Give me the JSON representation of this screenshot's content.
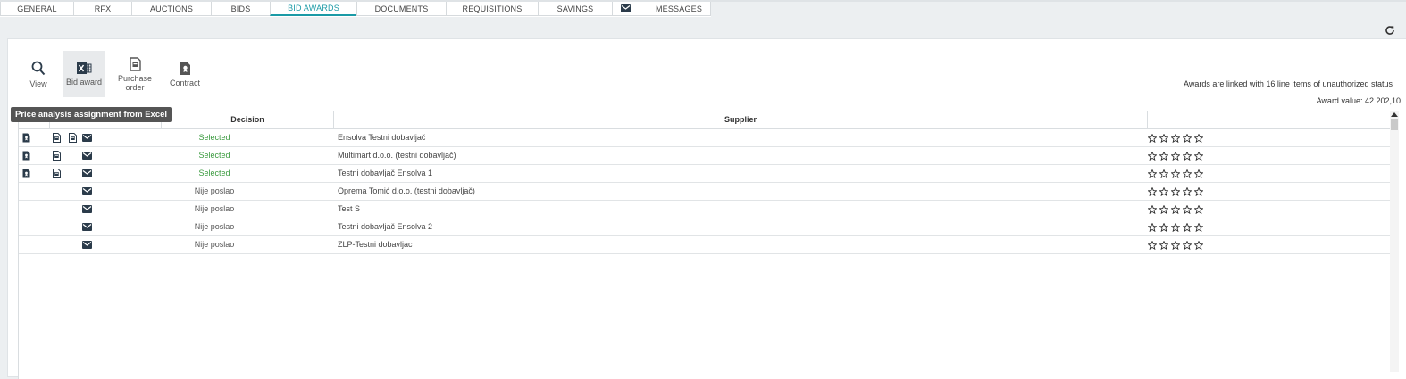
{
  "tabs": [
    {
      "label": "GENERAL",
      "active": false
    },
    {
      "label": "RFX",
      "active": false
    },
    {
      "label": "AUCTIONS",
      "active": false
    },
    {
      "label": "BIDS",
      "active": false
    },
    {
      "label": "BID AWARDS",
      "active": true
    },
    {
      "label": "DOCUMENTS",
      "active": false
    },
    {
      "label": "REQUISITIONS",
      "active": false
    },
    {
      "label": "SAVINGS",
      "active": false
    },
    {
      "label": "MESSAGES",
      "active": false,
      "icon": "envelope-icon"
    }
  ],
  "toolbar": {
    "view_label": "View",
    "bid_award_label": "Bid award",
    "purchase_order_label_1": "Purchase",
    "purchase_order_label_2": "order",
    "contract_label": "Contract"
  },
  "info": {
    "linked_text": "Awards are linked with 16 line items of unauthorized status",
    "award_value_text": "Award value: 42.202,10"
  },
  "tooltip": "Price analysis assignment from Excel",
  "table": {
    "headers": {
      "decision": "Decision",
      "supplier": "Supplier"
    },
    "rows": [
      {
        "decision": "Selected",
        "supplier": "Ensolva Testni dobavljač"
      },
      {
        "decision": "Selected",
        "supplier": "Multimart d.o.o. (testni dobavljač)"
      },
      {
        "decision": "Selected",
        "supplier": "Testni dobavljač Ensolva 1"
      },
      {
        "decision": "Nije poslao",
        "supplier": "Oprema Tomić d.o.o. (testni dobavljač)"
      },
      {
        "decision": "Nije poslao",
        "supplier": "Test S"
      },
      {
        "decision": "Nije poslao",
        "supplier": "Testni dobavljač Ensolva 2"
      },
      {
        "decision": "Nije poslao",
        "supplier": "ZLP-Testni dobavljac"
      }
    ]
  },
  "colors": {
    "accent": "#1a9aa6",
    "selected": "#3a9a3e",
    "tooltip_bg": "#555555"
  }
}
